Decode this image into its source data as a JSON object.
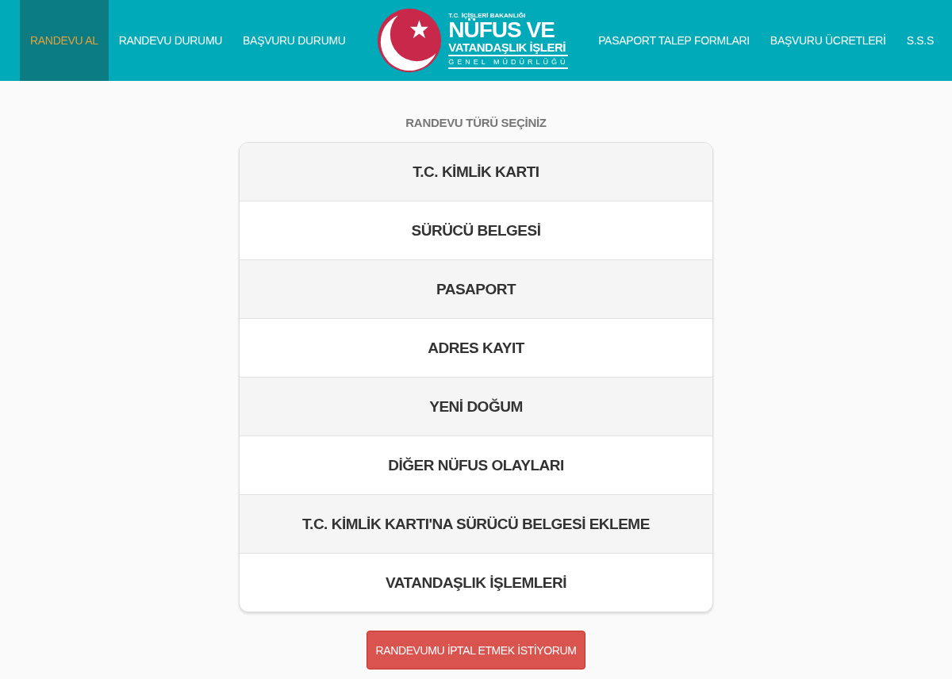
{
  "nav_left": [
    {
      "label": "RANDEVU AL",
      "selected": true
    },
    {
      "label": "RANDEVU DURUMU",
      "selected": false
    },
    {
      "label": "BAŞVURU DURUMU",
      "selected": false
    }
  ],
  "logo": {
    "ministry": "T.C. İÇİŞLERİ BAKANLIĞI",
    "title": "NÜFUS VE",
    "subtitle": "VATANDAŞLIK İŞLERİ",
    "department": "GENEL MÜDÜRLÜĞÜ"
  },
  "nav_right": [
    {
      "label": "PASAPORT TALEP FORMLARI",
      "selected": false
    },
    {
      "label": "BAŞVURU ÜCRETLERİ",
      "selected": false
    },
    {
      "label": "S.S.S",
      "selected": false
    }
  ],
  "heading": "RANDEVU TÜRÜ SEÇİNİZ",
  "options": [
    "T.C. KİMLİK KARTI",
    "SÜRÜCÜ BELGESİ",
    "PASAPORT",
    "ADRES KAYIT",
    "YENİ DOĞUM",
    "DİĞER NÜFUS OLAYLARI",
    "T.C. KİMLİK KARTI'NA SÜRÜCÜ BELGESİ EKLEME",
    "VATANDAŞLIK İŞLEMLERİ"
  ],
  "cancel_button": "RANDEVUMU İPTAL ETMEK İSTİYORUM"
}
